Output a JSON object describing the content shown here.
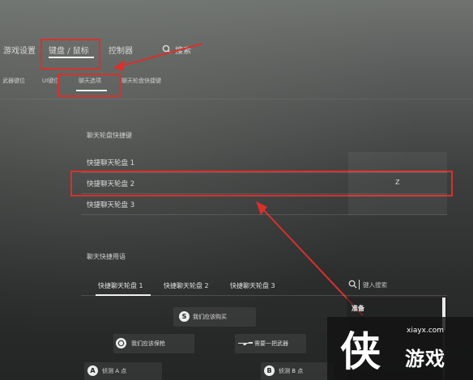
{
  "top_nav": {
    "items": [
      {
        "label": "游戏设置"
      },
      {
        "label": "键盘 / 鼠标"
      },
      {
        "label": "控制器"
      }
    ],
    "search_label": "搜索"
  },
  "sub_nav": {
    "items": [
      {
        "label": "武器键位"
      },
      {
        "label": "UI键位"
      },
      {
        "label": "聊天选项"
      },
      {
        "label": "聊天轮盘快捷键"
      }
    ]
  },
  "wheel_section": {
    "title": "聊天轮盘快捷键",
    "rows": [
      {
        "label": "快捷聊天轮盘 1",
        "key": ""
      },
      {
        "label": "快捷聊天轮盘 2",
        "key": "Z"
      },
      {
        "label": "快捷聊天轮盘 3",
        "key": ""
      }
    ]
  },
  "phrases_section": {
    "title": "聊天快捷用语",
    "tabs": [
      {
        "label": "快捷聊天轮盘 1"
      },
      {
        "label": "快捷聊天轮盘 2"
      },
      {
        "label": "快捷聊天轮盘 3"
      }
    ],
    "search_placeholder": "键入搜索",
    "buttons": [
      {
        "label": "我们应该购买",
        "icon": "S"
      },
      {
        "label": "我们应该保枪",
        "icon": ""
      },
      {
        "label": "需要一把武器",
        "icon": ""
      },
      {
        "label": "侦测 A 点",
        "icon": "A"
      },
      {
        "label": "侦测 B 点",
        "icon": "B"
      }
    ],
    "side_panel_header": "准备"
  },
  "watermark": {
    "site": "xiayx.com",
    "brand": "游戏",
    "logo_char": "侠"
  },
  "colors": {
    "highlight_red": "#d9302c"
  }
}
